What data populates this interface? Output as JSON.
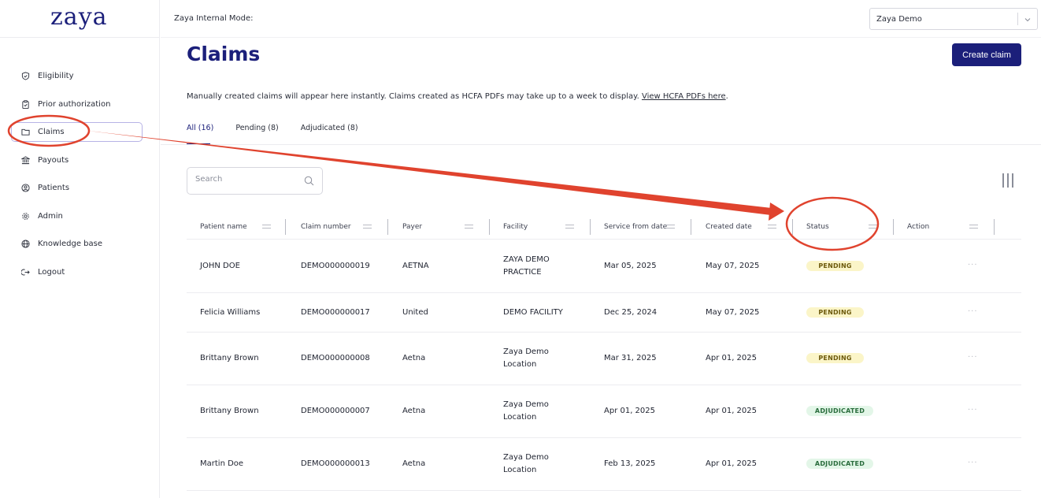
{
  "sidebar": {
    "logo": "zaya",
    "items": [
      {
        "label": "Eligibility",
        "icon": "shield-check-icon"
      },
      {
        "label": "Prior authorization",
        "icon": "clipboard-check-icon"
      },
      {
        "label": "Claims",
        "icon": "folder-icon",
        "active": true
      },
      {
        "label": "Payouts",
        "icon": "bank-icon"
      },
      {
        "label": "Patients",
        "icon": "user-circle-icon"
      },
      {
        "label": "Admin",
        "icon": "gear-icon"
      },
      {
        "label": "Knowledge base",
        "icon": "globe-icon"
      },
      {
        "label": "Logout",
        "icon": "logout-icon"
      }
    ]
  },
  "topbar": {
    "mode_label": "Zaya Internal Mode:",
    "org_select_value": "Zaya Demo"
  },
  "main": {
    "title": "Claims",
    "create_button": "Create claim",
    "notice": "Manually created claims will appear here instantly. Claims created as HCFA PDFs may take up to a week to display. ",
    "notice_link": "View HCFA PDFs here",
    "notice_end": ".",
    "tabs": [
      {
        "label": "All (16)",
        "active": true
      },
      {
        "label": "Pending (8)"
      },
      {
        "label": "Adjudicated (8)"
      }
    ],
    "search_placeholder": "Search"
  },
  "table": {
    "columns": [
      "Patient name",
      "Claim number",
      "Payer",
      "Facility",
      "Service from date",
      "Created date",
      "Status",
      "Action"
    ],
    "rows": [
      {
        "patient": "JOHN DOE",
        "claim": "DEMO000000019",
        "payer": "AETNA",
        "facility": [
          "ZAYA DEMO",
          "PRACTICE"
        ],
        "service": "Mar 05, 2025",
        "created": "May 07, 2025",
        "status": "PENDING",
        "action": "···"
      },
      {
        "patient": "Felicia Williams",
        "claim": "DEMO000000017",
        "payer": "United",
        "facility": [
          "DEMO FACILITY",
          ""
        ],
        "service": "Dec 25, 2024",
        "created": "May 07, 2025",
        "status": "PENDING",
        "action": "···"
      },
      {
        "patient": "Brittany Brown",
        "claim": "DEMO000000008",
        "payer": "Aetna",
        "facility": [
          "Zaya Demo",
          "Location"
        ],
        "service": "Mar 31, 2025",
        "created": "Apr 01, 2025",
        "status": "PENDING",
        "action": "···"
      },
      {
        "patient": "Brittany Brown",
        "claim": "DEMO000000007",
        "payer": "Aetna",
        "facility": [
          "Zaya Demo",
          "Location"
        ],
        "service": "Apr 01, 2025",
        "created": "Apr 01, 2025",
        "status": "ADJUDICATED",
        "action": "···"
      },
      {
        "patient": "Martin Doe",
        "claim": "DEMO000000013",
        "payer": "Aetna",
        "facility": [
          "Zaya Demo",
          "Location"
        ],
        "service": "Feb 13, 2025",
        "created": "Apr 01, 2025",
        "status": "ADJUDICATED",
        "action": "···"
      }
    ]
  },
  "colors": {
    "brand": "#1b1f7a",
    "annotation": "#e0432e",
    "pending_bg": "#fbf5c8",
    "adjudicated_bg": "#e3f6e8"
  }
}
